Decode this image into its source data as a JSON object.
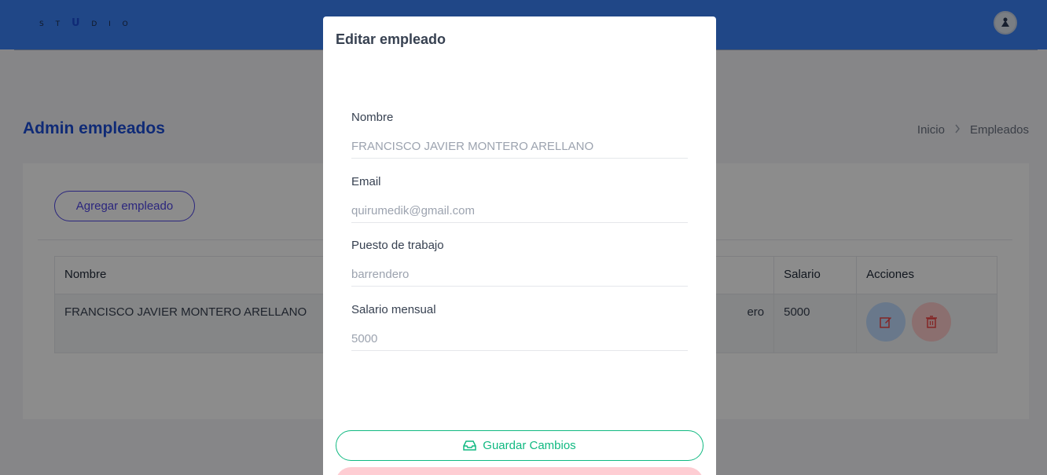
{
  "header": {
    "logo_text": "STUDIO"
  },
  "page": {
    "title": "Admin empleados",
    "breadcrumb": [
      "Inicio",
      "Empleados"
    ]
  },
  "card": {
    "add_button_label": "Agregar empleado",
    "table": {
      "columns": [
        "Nombre",
        "",
        "Salario",
        "Acciones"
      ],
      "rows": [
        {
          "nombre": "FRANCISCO JAVIER MONTERO ARELLANO",
          "puesto_partial": "ero",
          "salario": "5000"
        }
      ]
    }
  },
  "modal": {
    "title": "Editar empleado",
    "fields": [
      {
        "label": "Nombre",
        "value": "FRANCISCO JAVIER MONTERO ARELLANO"
      },
      {
        "label": "Email",
        "value": "quirumedik@gmail.com"
      },
      {
        "label": "Puesto de trabajo",
        "value": "barrendero"
      },
      {
        "label": "Salario mensual",
        "value": "5000"
      }
    ],
    "save_label": "Guardar Cambios"
  },
  "colors": {
    "topbar": "#3b82f6",
    "primary": "#1d4ed8",
    "success": "#10b981",
    "danger": "#ef4444"
  },
  "icons": {
    "avatar": "user-avatar-icon",
    "edit": "edit-icon",
    "delete": "trash-icon",
    "save": "inbox-icon",
    "breadcrumb_sep": "chevron-right-icon"
  }
}
